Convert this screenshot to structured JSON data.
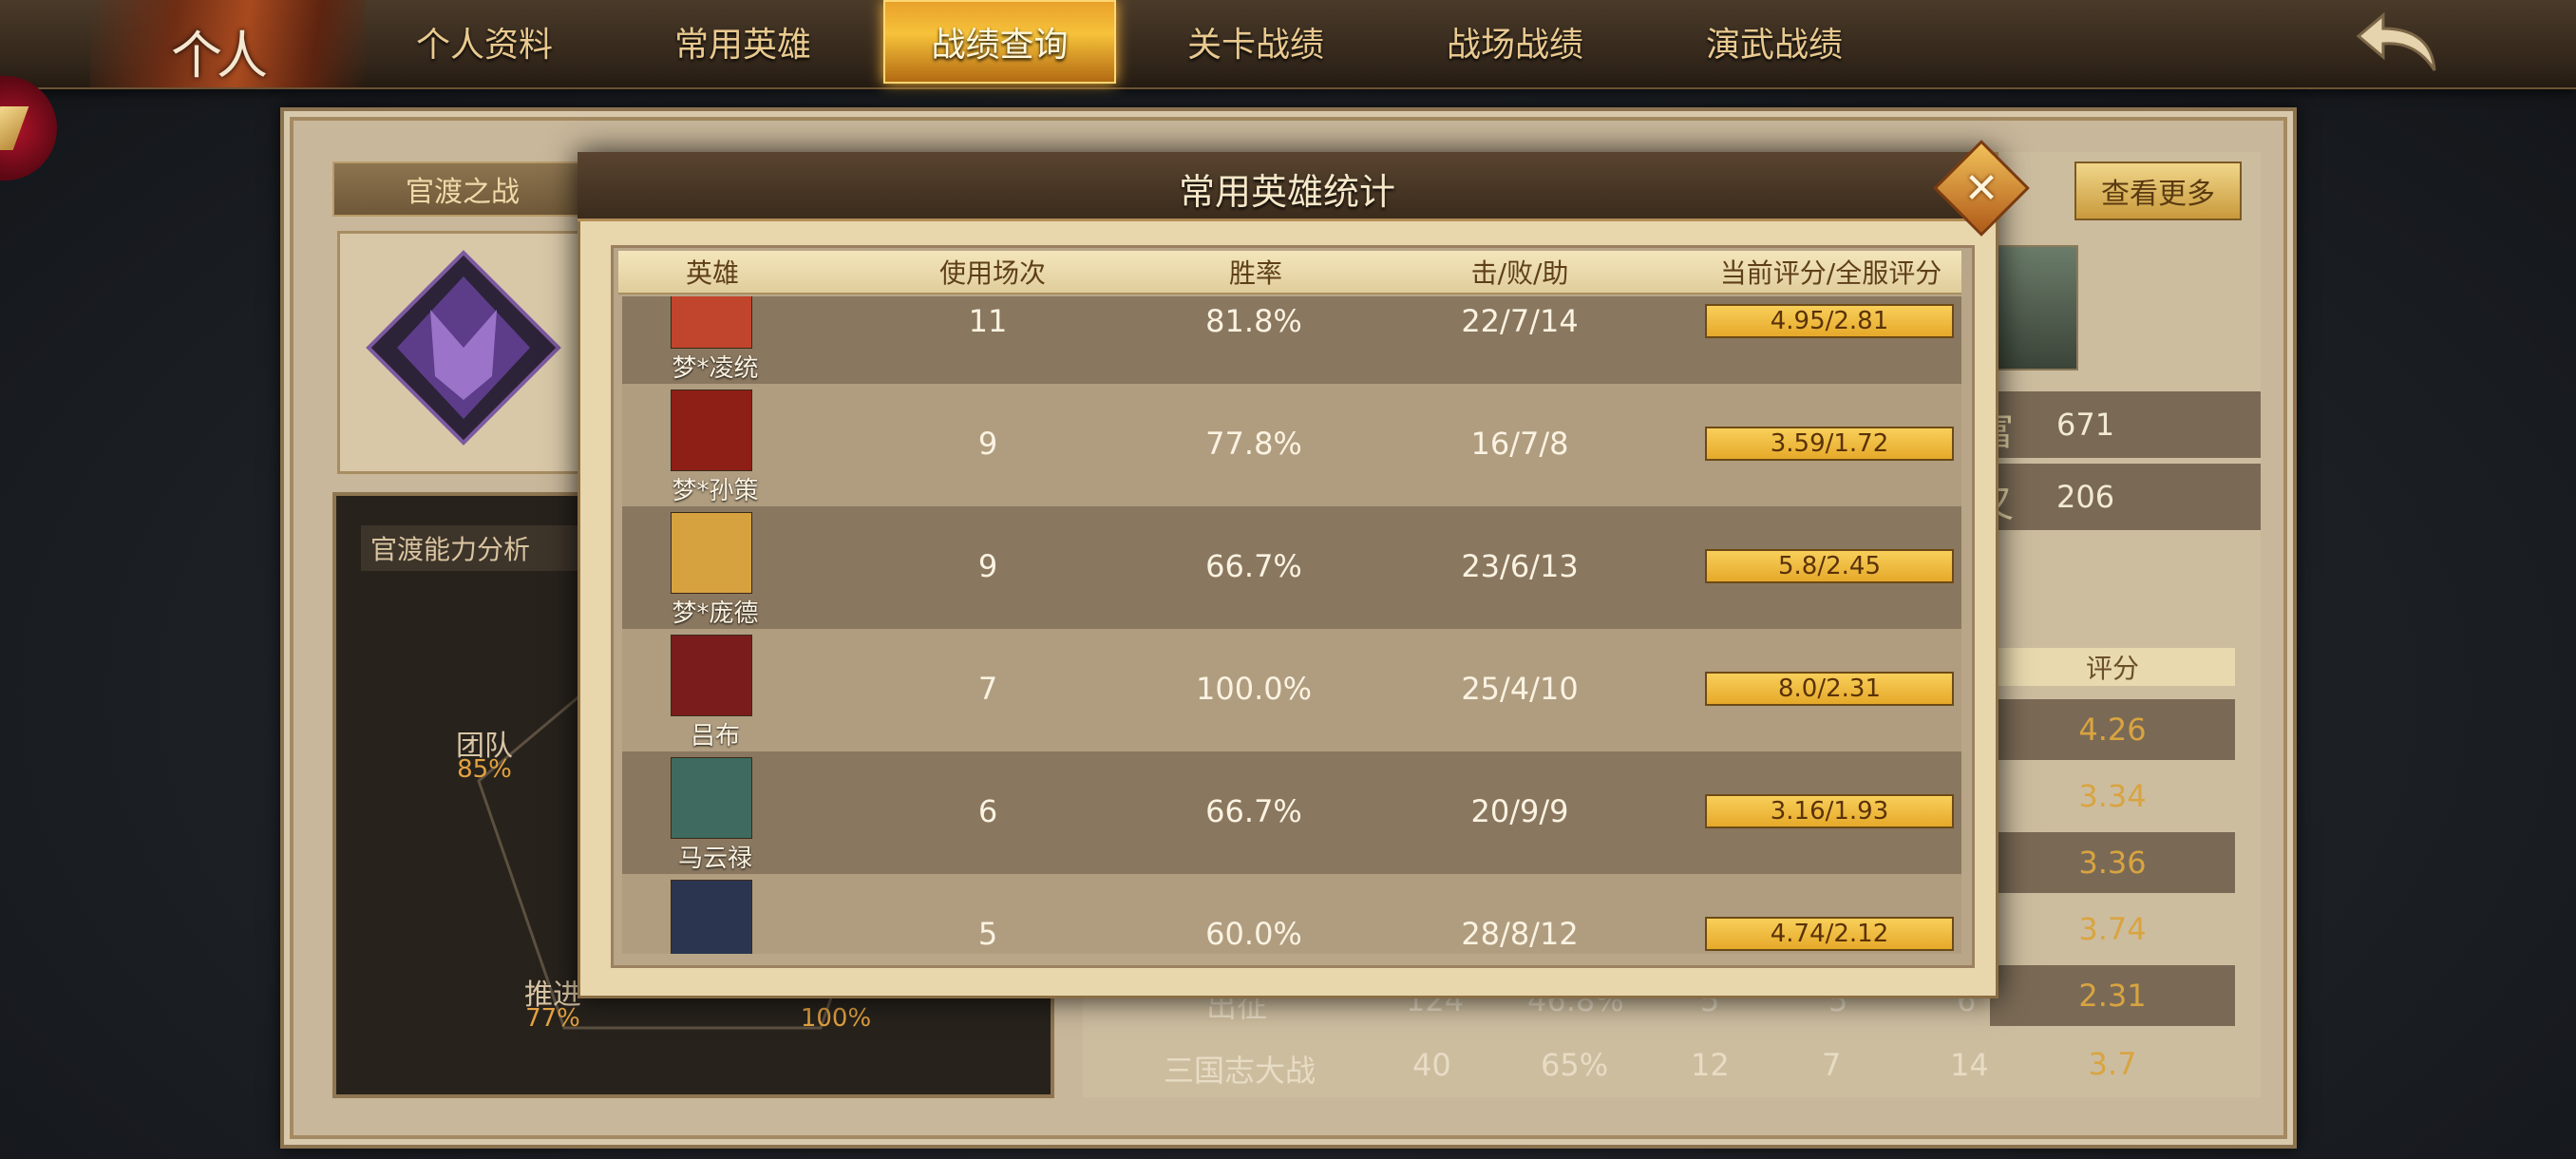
{
  "nav": {
    "logo": "个人",
    "tabs": [
      {
        "label": "个人资料"
      },
      {
        "label": "常用英雄"
      },
      {
        "label": "战绩查询"
      },
      {
        "label": "关卡战绩"
      },
      {
        "label": "战场战绩"
      },
      {
        "label": "演武战绩"
      }
    ],
    "active_tab": "战绩查询"
  },
  "background": {
    "map_name": "官渡之战",
    "ability_title": "官渡能力分析",
    "stats": [
      {
        "label": "团队",
        "value": "85%"
      },
      {
        "label": "推进",
        "value": "77%"
      },
      {
        "label": "",
        "value": "100%"
      }
    ],
    "more_button": "查看更多",
    "resources": [
      {
        "icon": "富",
        "value": "671"
      },
      {
        "icon": "叉",
        "value": "206"
      }
    ],
    "score_header": "评分",
    "scores": [
      "4.26",
      "3.34",
      "3.36",
      "3.74",
      "2.31",
      "3.7"
    ],
    "partial_rows": [
      {
        "name": "出征",
        "c1": "124",
        "c2": "46.8%",
        "c3": "5",
        "c4": "5",
        "c5": "6"
      },
      {
        "name": "三国志大战",
        "c1": "40",
        "c2": "65%",
        "c3": "12",
        "c4": "7",
        "c5": "14"
      }
    ]
  },
  "modal": {
    "title": "常用英雄统计",
    "columns": [
      "英雄",
      "使用场次",
      "胜率",
      "击/败/助",
      "当前评分/全服评分"
    ],
    "rows": [
      {
        "hero": "梦*凌统",
        "games": "11",
        "winrate": "81.8%",
        "kda": "22/7/14",
        "score": "4.95/2.81",
        "portrait_color": "#c1442c"
      },
      {
        "hero": "梦*孙策",
        "games": "9",
        "winrate": "77.8%",
        "kda": "16/7/8",
        "score": "3.59/1.72",
        "portrait_color": "#8e1f16"
      },
      {
        "hero": "梦*庞德",
        "games": "9",
        "winrate": "66.7%",
        "kda": "23/6/13",
        "score": "5.8/2.45",
        "portrait_color": "#d6a240"
      },
      {
        "hero": "吕布",
        "games": "7",
        "winrate": "100.0%",
        "kda": "25/4/10",
        "score": "8.0/2.31",
        "portrait_color": "#7a1c1c"
      },
      {
        "hero": "马云禄",
        "games": "6",
        "winrate": "66.7%",
        "kda": "20/9/9",
        "score": "3.16/1.93",
        "portrait_color": "#3e6a5f"
      },
      {
        "hero": "",
        "games": "5",
        "winrate": "60.0%",
        "kda": "28/8/12",
        "score": "4.74/2.12",
        "portrait_color": "#2b3550"
      }
    ]
  }
}
